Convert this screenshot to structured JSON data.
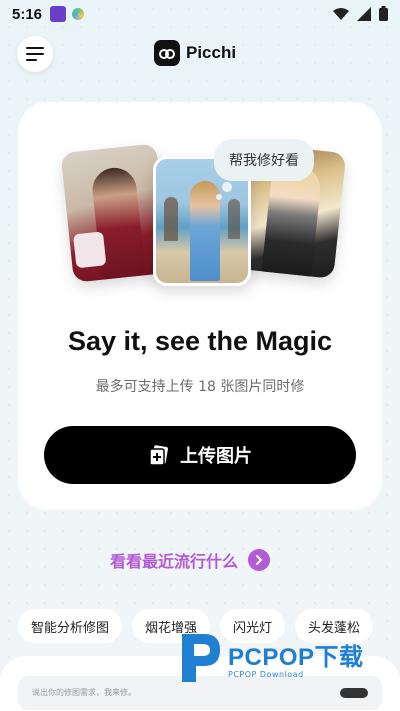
{
  "status_bar": {
    "time": "5:16"
  },
  "header": {
    "app_name": "Picchi"
  },
  "card": {
    "bubble_text": "帮我修好看",
    "headline": "Say it, see the Magic",
    "subtitle": "最多可支持上传 18 张图片同时修",
    "upload_label": "上传图片"
  },
  "trending": {
    "label": "看看最近流行什么"
  },
  "chips": [
    "智能分析修图",
    "烟花增强",
    "闪光灯",
    "头发蓬松"
  ],
  "input": {
    "placeholder": "说出你的修图需求，我来修。"
  },
  "watermark": {
    "title": "PCPOP下载",
    "subtitle": "PCPOP Download"
  },
  "colors": {
    "accent": "#b35ad6",
    "button": "#000000",
    "watermark": "#1f7fd1"
  }
}
